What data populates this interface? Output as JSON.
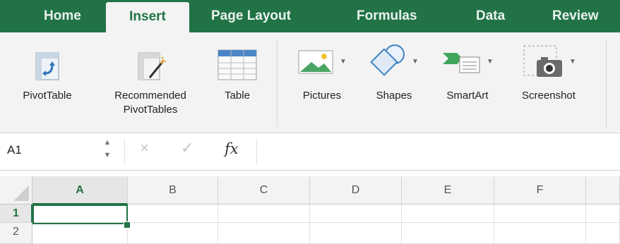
{
  "tabs": [
    {
      "label": "Home"
    },
    {
      "label": "Insert",
      "active": true
    },
    {
      "label": "Page Layout"
    },
    {
      "label": "Formulas"
    },
    {
      "label": "Data"
    },
    {
      "label": "Review"
    }
  ],
  "ribbon": {
    "pivottable": {
      "label": "PivotTable",
      "icon": "pivottable-icon"
    },
    "recommended": {
      "label": "Recommended PivotTables",
      "icon": "recommended-pivottables-icon"
    },
    "table": {
      "label": "Table",
      "icon": "table-icon"
    },
    "pictures": {
      "label": "Pictures",
      "icon": "pictures-icon"
    },
    "shapes": {
      "label": "Shapes",
      "icon": "shapes-icon"
    },
    "smartart": {
      "label": "SmartArt",
      "icon": "smartart-icon"
    },
    "screenshot": {
      "label": "Screenshot",
      "icon": "screenshot-icon"
    }
  },
  "formula_bar": {
    "name_box": "A1",
    "cancel_symbol": "×",
    "enter_symbol": "✓",
    "fx_label": "fx",
    "value": ""
  },
  "grid": {
    "columns": [
      "A",
      "B",
      "C",
      "D",
      "E",
      "F"
    ],
    "rows": [
      "1",
      "2"
    ],
    "active_cell": "A1"
  },
  "colors": {
    "accent": "#217346",
    "ribbon_bg": "#f3f3f3",
    "header_bg": "#f3f3f3"
  }
}
